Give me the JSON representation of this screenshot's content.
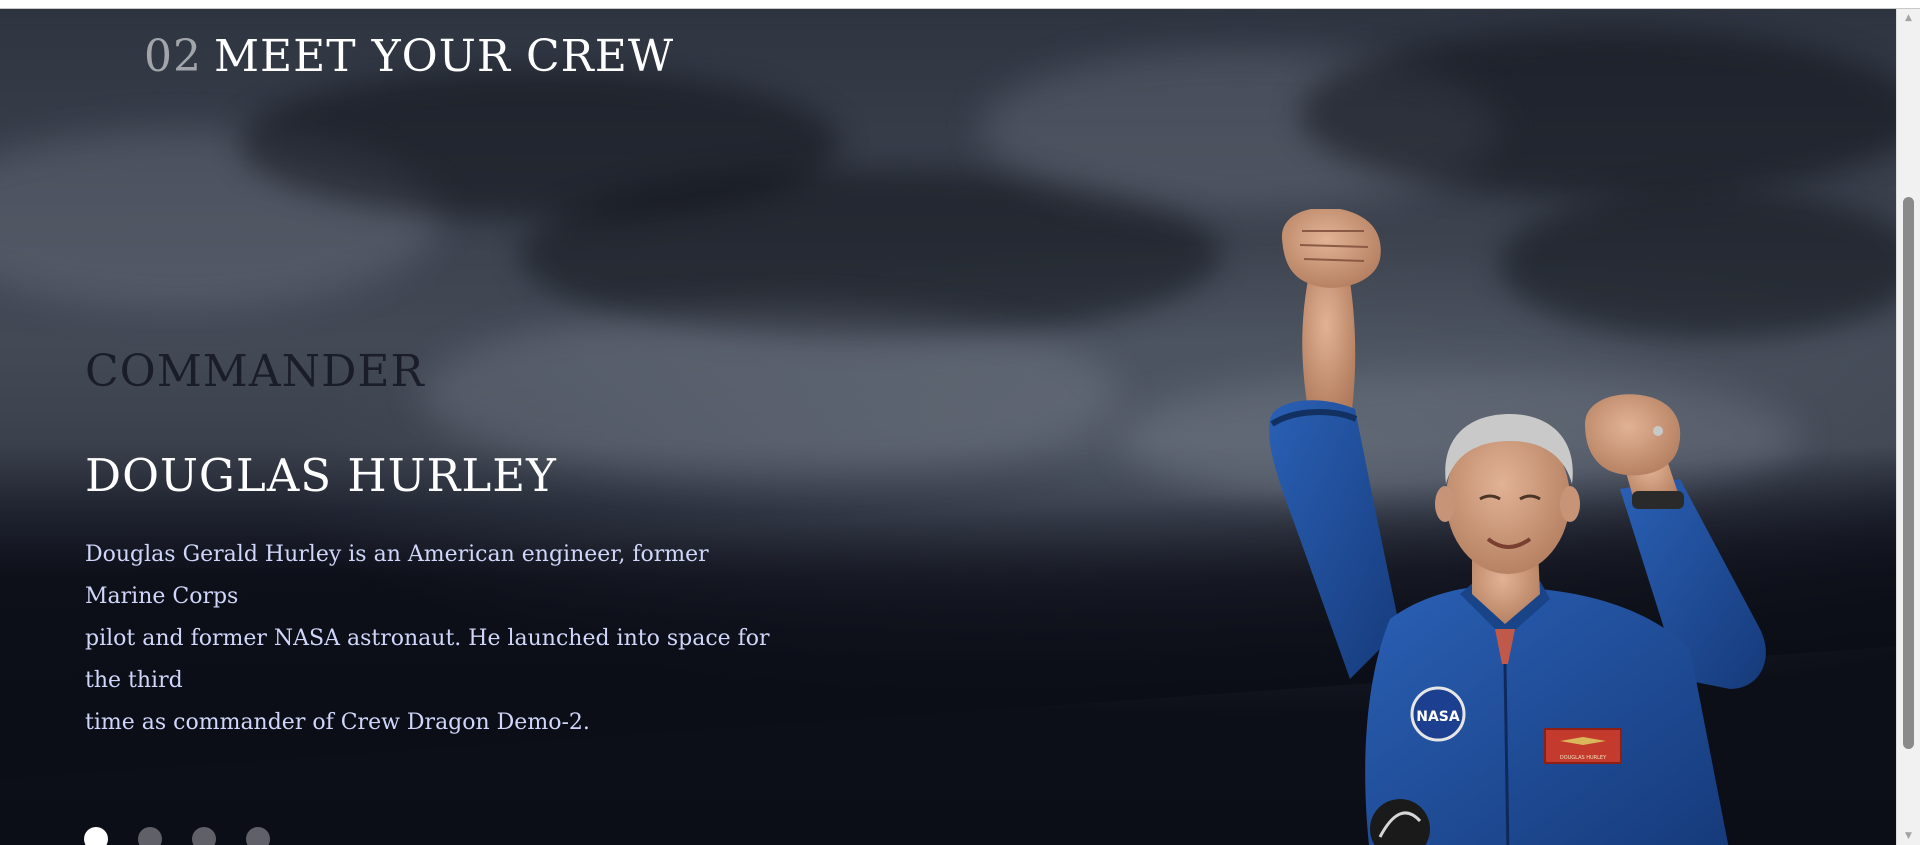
{
  "header": {
    "number": "02",
    "title": "MEET YOUR CREW"
  },
  "crew": {
    "role": "COMMANDER",
    "name": "DOUGLAS HURLEY",
    "bio_lines": [
      "Douglas Gerald Hurley is an American engineer, former Marine Corps",
      "pilot and former NASA astronaut. He launched into space for the third",
      "time as commander of Crew Dragon Demo-2."
    ]
  },
  "carousel": {
    "count": 4,
    "active_index": 0
  },
  "figure": {
    "badge_text": "NASA",
    "name_tag": "DOUGLAS HURLEY"
  },
  "colors": {
    "background": "#0b0d17",
    "text": "#ffffff",
    "body_text": "#d0d6f9",
    "suit": "#1f4e9a"
  },
  "scrollbar": {
    "up_icon": "scroll-up-arrow-icon",
    "down_icon": "scroll-down-arrow-icon"
  }
}
